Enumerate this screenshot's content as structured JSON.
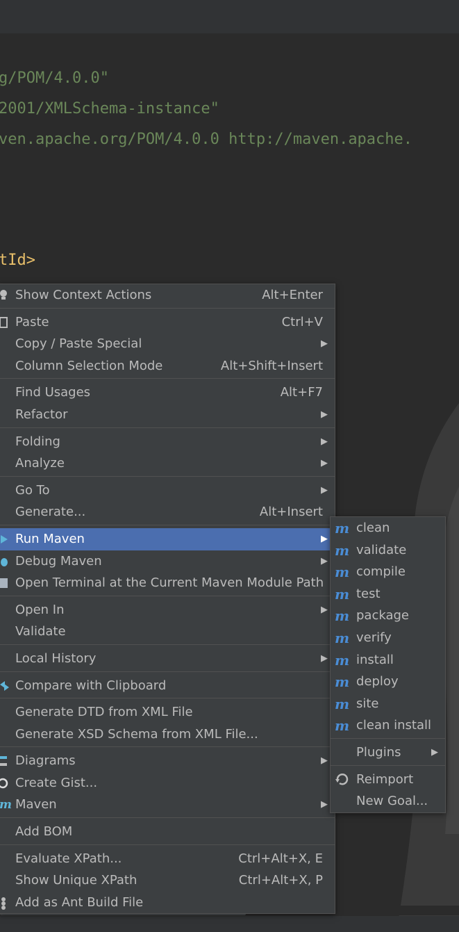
{
  "code_lines": [
    "g/POM/4.0.0\"",
    "2001/XMLSchema-instance\"",
    "ven.apache.org/POM/4.0.0 http://maven.apache.",
    "tId>"
  ],
  "context_menu": {
    "items": [
      {
        "label": "Show Context Actions",
        "shortcut": "Alt+Enter"
      },
      {
        "label": "Paste",
        "shortcut": "Ctrl+V"
      },
      {
        "label": "Copy / Paste Special"
      },
      {
        "label": "Column Selection Mode",
        "shortcut": "Alt+Shift+Insert"
      },
      {
        "label": "Find Usages",
        "shortcut": "Alt+F7"
      },
      {
        "label": "Refactor"
      },
      {
        "label": "Folding"
      },
      {
        "label": "Analyze"
      },
      {
        "label": "Go To"
      },
      {
        "label": "Generate...",
        "shortcut": "Alt+Insert"
      },
      {
        "label": "Run Maven"
      },
      {
        "label": "Debug Maven"
      },
      {
        "label": "Open Terminal at the Current Maven Module Path"
      },
      {
        "label": "Open In"
      },
      {
        "label": "Validate"
      },
      {
        "label": "Local History"
      },
      {
        "label": "Compare with Clipboard"
      },
      {
        "label": "Generate DTD from XML File"
      },
      {
        "label": "Generate XSD Schema from XML File..."
      },
      {
        "label": "Diagrams"
      },
      {
        "label": "Create Gist..."
      },
      {
        "label": "Maven"
      },
      {
        "label": "Add BOM"
      },
      {
        "label": "Evaluate XPath...",
        "shortcut": "Ctrl+Alt+X, E"
      },
      {
        "label": "Show Unique XPath",
        "shortcut": "Ctrl+Alt+X, P"
      },
      {
        "label": "Add as Ant Build File"
      }
    ],
    "submenu_arrow": "▶"
  },
  "maven_submenu": {
    "goals": [
      "clean",
      "validate",
      "compile",
      "test",
      "package",
      "verify",
      "install",
      "deploy",
      "site",
      "clean install"
    ],
    "plugins_label": "Plugins",
    "reimport_label": "Reimport",
    "new_goal_label": "New Goal...",
    "goal_icon_name": "maven-goal-icon",
    "goal_icon_glyph": "m"
  },
  "colors": {
    "editor_bg": "#2b2b2b",
    "menu_bg": "#3c3f41",
    "selection": "#4b6eaf",
    "string_green": "#6a8759",
    "tag_yellow": "#e8bf6a"
  }
}
